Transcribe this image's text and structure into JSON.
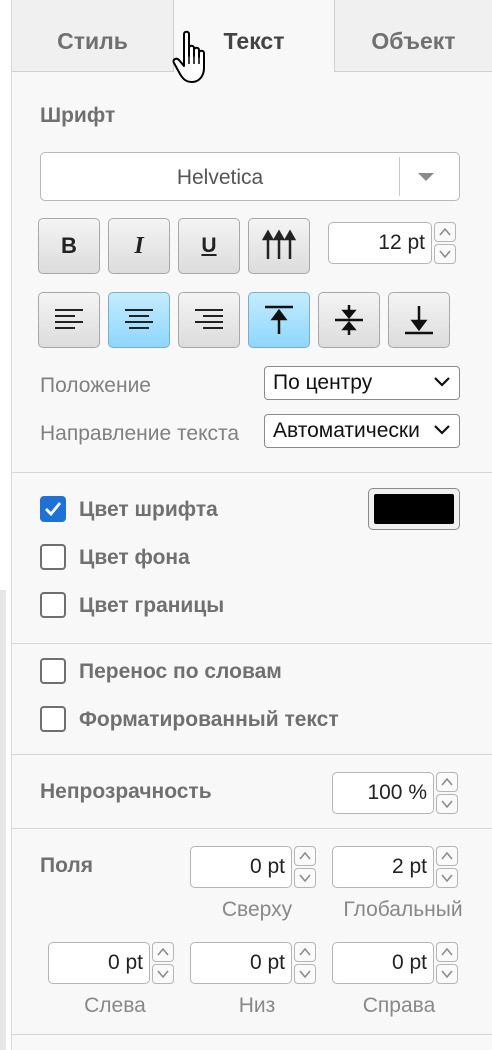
{
  "tabs": [
    {
      "label": "Стиль"
    },
    {
      "label": "Текст"
    },
    {
      "label": "Объект"
    }
  ],
  "font": {
    "section_title": "Шрифт",
    "family": "Helvetica",
    "size": "12 pt"
  },
  "format_buttons": {
    "bold": "B",
    "italic": "I",
    "underline": "U"
  },
  "position": {
    "label": "Положение",
    "value": "По центру"
  },
  "direction": {
    "label": "Направление текста",
    "value": "Автоматически"
  },
  "colors": {
    "font_color_label": "Цвет шрифта",
    "font_color_checked": true,
    "font_color_value": "#000000",
    "background_label": "Цвет фона",
    "background_checked": false,
    "border_label": "Цвет границы",
    "border_checked": false
  },
  "text_options": {
    "word_wrap_label": "Перенос по словам",
    "word_wrap_checked": false,
    "formatted_label": "Форматированный текст",
    "formatted_checked": false
  },
  "opacity": {
    "label": "Непрозрачность",
    "value": "100 %"
  },
  "margins": {
    "label": "Поля",
    "top_value": "0 pt",
    "top_caption": "Сверху",
    "global_value": "2 pt",
    "global_caption": "Глобальный",
    "left_value": "0 pt",
    "left_caption": "Слева",
    "bottom_value": "0 pt",
    "bottom_caption": "Низ",
    "right_value": "0 pt",
    "right_caption": "Справа"
  },
  "accent_color": "#1e72d6",
  "active_button_color": "#8fd6fd"
}
